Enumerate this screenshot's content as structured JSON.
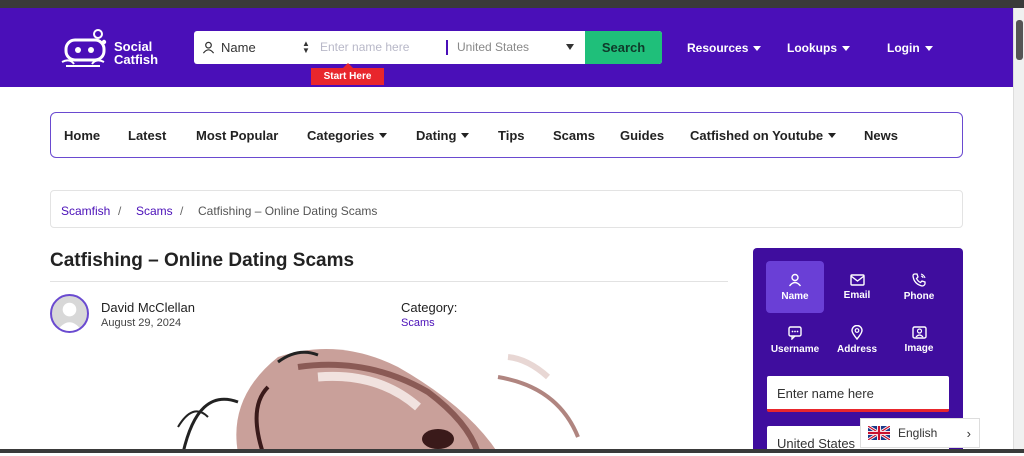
{
  "brand": {
    "name_line1": "Social",
    "name_line2": "Catfish",
    "primary": "#4a0fb8",
    "accent_green": "#1fbf7a",
    "accent_red": "#e8262c"
  },
  "search": {
    "type_selected": "Name",
    "name_placeholder": "Enter name here",
    "state_selected": "United States",
    "button": "Search",
    "hint": "Start Here"
  },
  "topnav": {
    "resources": "Resources",
    "lookups": "Lookups",
    "login": "Login"
  },
  "mainnav": {
    "home": "Home",
    "latest": "Latest",
    "popular": "Most Popular",
    "categories": "Categories",
    "dating": "Dating",
    "tips": "Tips",
    "scams": "Scams",
    "guides": "Guides",
    "youtube": "Catfished on Youtube",
    "news": "News"
  },
  "breadcrumb": {
    "root": "Scamfish",
    "sep": "/",
    "parent": "Scams",
    "current": "Catfishing – Online Dating Scams"
  },
  "article": {
    "title": "Catfishing – Online Dating Scams",
    "author": "David McClellan",
    "date": "August 29, 2024",
    "category_label": "Category:",
    "category": "Scams"
  },
  "widget": {
    "tabs": {
      "name": "Name",
      "email": "Email",
      "phone": "Phone",
      "username": "Username",
      "address": "Address",
      "image": "Image"
    },
    "input_placeholder": "Enter name here",
    "state_partial": "United States"
  },
  "language": {
    "label": "English"
  }
}
